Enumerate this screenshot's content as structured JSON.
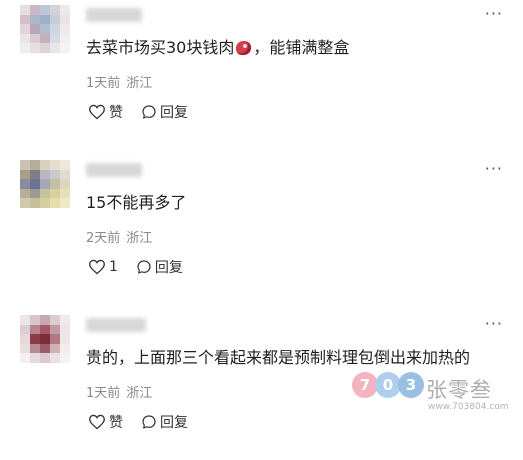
{
  "comments": [
    {
      "text_before": "去菜市场买30块钱肉",
      "text_after": "，能铺满整盒",
      "emoji": "meat-emoji",
      "time": "1天前",
      "location": "浙江",
      "like_label": "赞",
      "reply_label": "回复"
    },
    {
      "text": "15不能再多了",
      "time": "2天前",
      "location": "浙江",
      "like_count": "1",
      "reply_label": "回复"
    },
    {
      "text": "贵的，上面那三个看起来都是预制料理包倒出来加热的",
      "time": "1天前",
      "location": "浙江",
      "like_label": "赞",
      "reply_label": "回复"
    }
  ],
  "more_label": "···",
  "watermark": {
    "logo_text": "703",
    "name": "张零叁",
    "url": "www.703804.com"
  }
}
